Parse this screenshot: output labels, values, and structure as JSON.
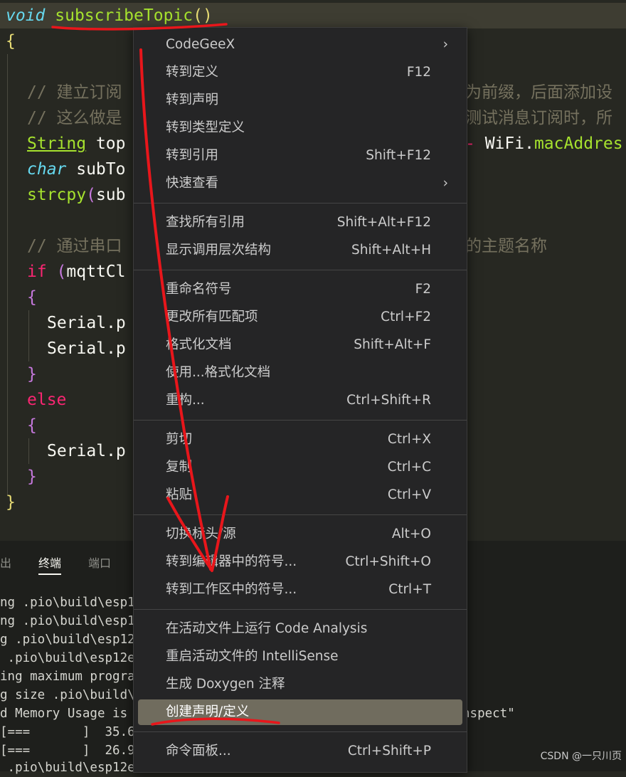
{
  "code": {
    "lines": [
      {
        "void": "void",
        "name": "subscribeTopic",
        "parens": "()"
      },
      {
        "brace": "{"
      },
      {
        "comment": "// 建立订阅"
      },
      {
        "comment": "// 这么做是"
      },
      {
        "type": "String",
        "text": " top"
      },
      {
        "type": "char",
        "text": " subTo"
      },
      {
        "fn": "strcpy",
        "paren": "(",
        "text": "sub"
      },
      {
        "comment": "// 通过串口"
      },
      {
        "kw": "if",
        "paren": " (",
        "text": "mqttCl"
      },
      {
        "brace": "{"
      },
      {
        "text": "Serial.p"
      },
      {
        "text": "Serial.p"
      },
      {
        "brace": "}"
      },
      {
        "kw": "else"
      },
      {
        "brace": "{"
      },
      {
        "text": "Serial.p"
      },
      {
        "brace": "}"
      },
      {
        "brace": "}"
      }
    ],
    "right_fragments": {
      "comment1": "为前缀，后面添加设",
      "comment2": "测试消息订阅时，所",
      "line_string_op": "-",
      "line_string_obj": " WiFi.",
      "line_string_member": "macAddres",
      "comment3": "的主题名称"
    }
  },
  "panel": {
    "tabs": [
      "出",
      "终端",
      "端口"
    ],
    "active_tab": "终端",
    "terminal": [
      "ng .pio\\build\\esp1",
      "ng .pio\\build\\esp1",
      "g .pio\\build\\esp12",
      " .pio\\build\\esp12e",
      "ing maximum progra",
      "g size .pio\\build\\",
      "d Memory Usage is",
      "[===       ]  35.6",
      "[===       ]  26.9",
      " .pio\\build\\esp12e"
    ],
    "term_right": "nspect\""
  },
  "menu": {
    "groups": [
      [
        {
          "label": "CodeGeeX",
          "shortcut": "",
          "submenu": true
        },
        {
          "label": "转到定义",
          "shortcut": "F12"
        },
        {
          "label": "转到声明",
          "shortcut": ""
        },
        {
          "label": "转到类型定义",
          "shortcut": ""
        },
        {
          "label": "转到引用",
          "shortcut": "Shift+F12"
        },
        {
          "label": "快速查看",
          "shortcut": "",
          "submenu": true
        }
      ],
      [
        {
          "label": "查找所有引用",
          "shortcut": "Shift+Alt+F12"
        },
        {
          "label": "显示调用层次结构",
          "shortcut": "Shift+Alt+H"
        }
      ],
      [
        {
          "label": "重命名符号",
          "shortcut": "F2"
        },
        {
          "label": "更改所有匹配项",
          "shortcut": "Ctrl+F2"
        },
        {
          "label": "格式化文档",
          "shortcut": "Shift+Alt+F"
        },
        {
          "label": "使用...格式化文档",
          "shortcut": ""
        },
        {
          "label": "重构...",
          "shortcut": "Ctrl+Shift+R"
        }
      ],
      [
        {
          "label": "剪切",
          "shortcut": "Ctrl+X"
        },
        {
          "label": "复制",
          "shortcut": "Ctrl+C"
        },
        {
          "label": "粘贴",
          "shortcut": "Ctrl+V"
        }
      ],
      [
        {
          "label": "切换标头/源",
          "shortcut": "Alt+O"
        },
        {
          "label": "转到编辑器中的符号...",
          "shortcut": "Ctrl+Shift+O"
        },
        {
          "label": "转到工作区中的符号...",
          "shortcut": "Ctrl+T"
        }
      ],
      [
        {
          "label": "在活动文件上运行 Code Analysis",
          "shortcut": ""
        },
        {
          "label": "重启活动文件的 IntelliSense",
          "shortcut": ""
        },
        {
          "label": "生成 Doxygen 注释",
          "shortcut": ""
        },
        {
          "label": "创建声明/定义",
          "shortcut": "",
          "highlighted": true
        }
      ],
      [
        {
          "label": "命令面板...",
          "shortcut": "Ctrl+Shift+P"
        }
      ]
    ],
    "submenu_glyph": "›"
  },
  "colors": {
    "annotation_red": "#e8161b",
    "menu_highlight": "#706c5e",
    "editor_bg": "#272822"
  },
  "watermark": "CSDN @一只川页"
}
